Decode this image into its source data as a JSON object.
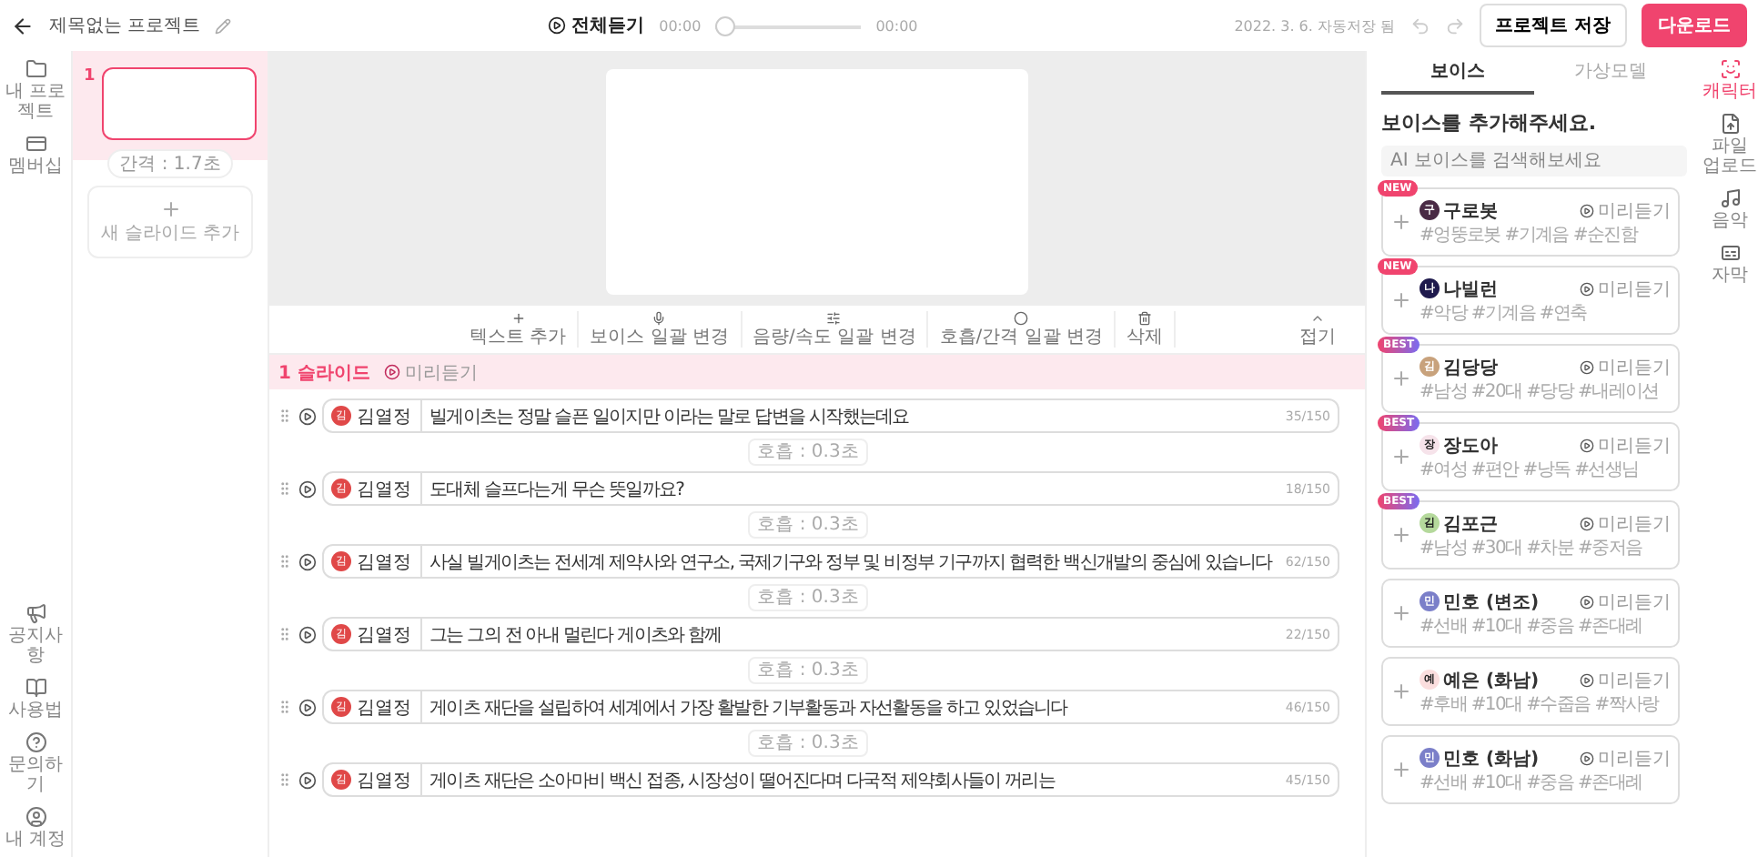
{
  "header": {
    "title": "제목없는 프로젝트",
    "play_all": "전체듣기",
    "time_start": "00:00",
    "time_end": "00:00",
    "playback": {
      "level": 0
    },
    "autosave": "2022. 3. 6. 자동저장 됨",
    "save_button": "프로젝트 저장",
    "download_button": "다운로드"
  },
  "left_nav": {
    "top": [
      {
        "label": "내 프로젝트"
      },
      {
        "label": "멤버십"
      }
    ],
    "bottom": [
      {
        "label": "공지사항"
      },
      {
        "label": "사용법"
      },
      {
        "label": "문의하기"
      },
      {
        "label": "내 계정"
      }
    ]
  },
  "slides": [
    {
      "number": "1",
      "selected": true,
      "gap": "간격 : 1.7초"
    }
  ],
  "add_slide": "새 슬라이드 추가",
  "toolbar": [
    {
      "label": "텍스트 추가"
    },
    {
      "label": "보이스 일괄 변경"
    },
    {
      "label": "음량/속도 일괄 변경"
    },
    {
      "label": "호흡/간격 일괄 변경"
    },
    {
      "label": "삭제"
    }
  ],
  "collapse": "접기",
  "slide_header": {
    "title": "1 슬라이드",
    "preview": "미리듣기"
  },
  "lines": [
    {
      "avatar": "김",
      "voice": "김열정",
      "text": "빌게이츠는 정말 슬픈 일이지만 이라는 말로 답변을 시작했는데요",
      "count": "35/150",
      "pause": "호흡 : 0.3초"
    },
    {
      "avatar": "김",
      "voice": "김열정",
      "text": "도대체 슬프다는게 무슨 뜻일까요?",
      "count": "18/150",
      "pause": "호흡 : 0.3초"
    },
    {
      "avatar": "김",
      "voice": "김열정",
      "text": "사실 빌게이츠는 전세계 제약사와 연구소, 국제기구와 정부 및 비정부 기구까지 협력한 백신개발의 중심에 있습니다",
      "count": "62/150",
      "pause": "호흡 : 0.3초"
    },
    {
      "avatar": "김",
      "voice": "김열정",
      "text": "그는 그의 전 아내 멀린다 게이츠와 함께",
      "count": "22/150",
      "pause": "호흡 : 0.3초"
    },
    {
      "avatar": "김",
      "voice": "김열정",
      "text": "게이츠 재단을 설립하여 세계에서 가장 활발한 기부활동과 자선활동을 하고 있었습니다",
      "count": "46/150",
      "pause": "호흡 : 0.3초"
    },
    {
      "avatar": "김",
      "voice": "김열정",
      "text": "게이츠 재단은 소아마비 백신 접종, 시장성이 떨어진다며 다국적 제약회사들이 꺼리는",
      "count": "45/150"
    }
  ],
  "voice_panel": {
    "tabs": [
      {
        "label": "보이스",
        "selected": true
      },
      {
        "label": "가상모델",
        "selected": false
      }
    ],
    "title": "보이스를 추가해주세요.",
    "search_placeholder": "AI 보이스를 검색해보세요",
    "voices": [
      {
        "badge": "NEW",
        "avatar": "구",
        "color": "#4a2a45",
        "name": "구로봇",
        "tags": "#엉뚱로봇 #기계음 #순진함",
        "preview": "미리듣기"
      },
      {
        "badge": "NEW",
        "avatar": "나",
        "color": "#1f1a4d",
        "name": "나빌런",
        "tags": "#악당 #기계음 #연축",
        "preview": "미리듣기"
      },
      {
        "badge": "BEST",
        "avatar": "김",
        "color": "#c8a27c",
        "name": "김당당",
        "tags": "#남성 #20대 #당당 #내레이션",
        "preview": "미리듣기"
      },
      {
        "badge": "BEST",
        "avatar": "장",
        "color": "#f6e3ea",
        "name": "장도아",
        "tags": "#여성 #편안 #낭독 #선생님",
        "preview": "미리듣기"
      },
      {
        "badge": "BEST",
        "avatar": "김",
        "color": "#b5d99c",
        "name": "김포근",
        "tags": "#남성 #30대 #차분 #중저음",
        "preview": "미리듣기"
      },
      {
        "avatar": "민",
        "color": "#7b7fc9",
        "name": "민호 (변조)",
        "tags": "#선배 #10대 #중음 #존대례",
        "preview": "미리듣기"
      },
      {
        "avatar": "예",
        "color": "#fbdede",
        "name": "예은 (화남)",
        "tags": "#후배 #10대 #수줍음 #짝사랑",
        "preview": "미리듣기"
      },
      {
        "avatar": "민",
        "color": "#7b7fc9",
        "name": "민호 (화남)",
        "tags": "#선배 #10대 #중음 #존대례",
        "preview": "미리듣기"
      }
    ]
  },
  "right_nav": [
    {
      "label": "캐릭터",
      "selected": true
    },
    {
      "label": "파일 업로드",
      "selected": false
    },
    {
      "label": "음악",
      "selected": false
    },
    {
      "label": "자막",
      "selected": false
    }
  ]
}
